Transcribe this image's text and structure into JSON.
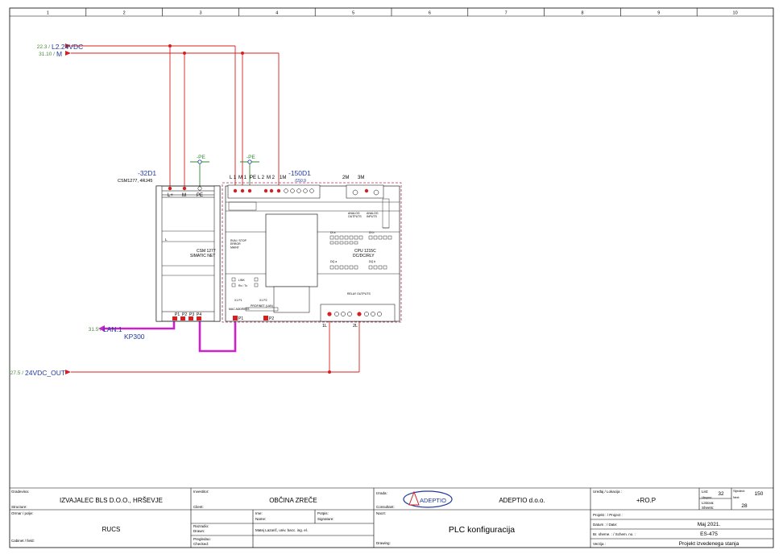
{
  "colors": {
    "wire": "#d42020",
    "ethernet": "#cc22cc",
    "label_blue": "#1f3a9e",
    "ref_green": "#4a8a3a",
    "pe_green": "#2e8b2e",
    "border": "#000000",
    "plc_outline": "#b03060"
  },
  "column_numbers": [
    "1",
    "2",
    "3",
    "4",
    "5",
    "6",
    "7",
    "8",
    "9",
    "10"
  ],
  "signals": {
    "l2_24vdc": {
      "ref": "22.3 /",
      "name": "L2.24VDC"
    },
    "m": {
      "ref": "31.10 /",
      "name": "M"
    },
    "lan1": {
      "ref": "31.5 /",
      "name": "LAN.1",
      "cable": "KP300"
    },
    "out_24vdc": {
      "ref": "27.5 /",
      "name": "24VDC_OUT"
    }
  },
  "pe_labels": [
    "-PE",
    "-PE"
  ],
  "csm": {
    "tag": "-32D1",
    "desc": "CSM1277, 4RJ45",
    "terminals": [
      "L+",
      "M",
      "PE"
    ],
    "name_line1": "CSM 1277",
    "name_line2": "SIMATIC NET",
    "l_label": "L",
    "ports": [
      "P1",
      "P2",
      "P3",
      "P4"
    ]
  },
  "cpu": {
    "tag": "-150D1",
    "sub": "/150.9",
    "top_terminals": [
      "L 1",
      "M 1",
      "PE",
      "L 2",
      "M 2",
      "1M"
    ],
    "right_terminals": [
      "2M",
      "3M"
    ],
    "analog_in": "ANALOG\nOUTPUTS",
    "analog_out": "ANALOG\nINPUTS",
    "di_label": "DI a",
    "di_b_label": "DI b",
    "name_line1": "CPU 1215C",
    "name_line2": "DC/DC/RLY",
    "dq_a": "DQ a",
    "dq_b": "DQ b",
    "relay_outputs": "RELAY OUTPUTS",
    "run_stop": "RUN / STOP\nERROR\nMAINT",
    "link": "LINK",
    "rxtx": "Rx / Tx",
    "profinet": "PROFINET (LAN)",
    "mac": "MAC ADDRESS",
    "x1p1": "X1 P1",
    "x1p2": "X1 P2",
    "ports": [
      "P1",
      "P2"
    ],
    "bottom_terminals": [
      "1L",
      "2L"
    ]
  },
  "title_block": {
    "gradevina_label": "Gradevina:",
    "structure_label": "Structure:",
    "izvajalec": "IZVAJALEC BLS D.O.O., HRŠEVJE",
    "investitor_label": "Investitor:",
    "client_label": "Client:",
    "investitor": "OBČINA ZREČE",
    "izrada_label": "Izrada:",
    "consultant_label": "Consultant:",
    "logo_text": "ADEPTIO",
    "company": "ADEPTIO d.o.o.",
    "uredaj_label": "Uređaj / Lokacija :",
    "location": "+RO.P",
    "list_label": "List:",
    "list_value": "32",
    "sledeci_label": "Sljedeći:",
    "sledeci_value": "150",
    "ukupno_label": "Ukupno:",
    "next_label": "Next:",
    "listova_label": "Listova:",
    "sheets_label": "Sheets:",
    "sheets_value": "28",
    "ormar_label": "Ormar / polje:",
    "cabinet_label": "Cabinet / field:",
    "ormar": "RUCS",
    "razradio_label": "Razradio:",
    "drawn_label": "Drawn:",
    "pregledao_label": "Pregledao:",
    "checked_label": "Checked:",
    "ime_label": "Ime:",
    "name_label": "Name:",
    "potpis_label": "Potpis:",
    "signature_label": "Signature:",
    "drawn_by": "Matej Lazarič, univ. bacc. ing. el.",
    "nacrt_label": "Nacrt:",
    "drawing_label": "Drawing:",
    "drawing": "PLC konfiguracija",
    "projekt_label": "Projekt :  / Project :",
    "datum_label": "Datum :  / Date:",
    "datum": "Maj 2021.",
    "br_label": "Br. sheme. :  / Schem. no. :",
    "schem_no": "ES-475",
    "verzija_label": "Verzija :",
    "verzija": "Projekt izvedenega stanja"
  }
}
